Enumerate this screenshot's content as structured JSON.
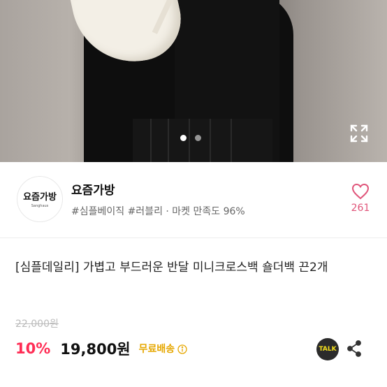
{
  "gallery": {
    "dots": [
      {
        "active": true
      },
      {
        "active": false
      }
    ]
  },
  "store": {
    "logo_text": "요즘가방",
    "logo_subtext": "Sanghaus",
    "name": "요즘가방",
    "tags": "#심플베이직 #러블리 · 마켓 만족도 96%",
    "likes": "261"
  },
  "product": {
    "title": "[심플데일리] 가볍고 부드러운 반달 미니크로스백 숄더백 끈2개",
    "original_price": "22,000원",
    "discount": "10%",
    "price": "19,800원",
    "shipping": "무료배송"
  },
  "actions": {
    "talk_label": "TALK"
  },
  "colors": {
    "discount": "#ff2d55",
    "shipping": "#e6a700",
    "heart": "#e0557a"
  },
  "icons": [
    "expand-icon",
    "heart-icon",
    "info-icon",
    "talk-icon",
    "share-icon"
  ]
}
